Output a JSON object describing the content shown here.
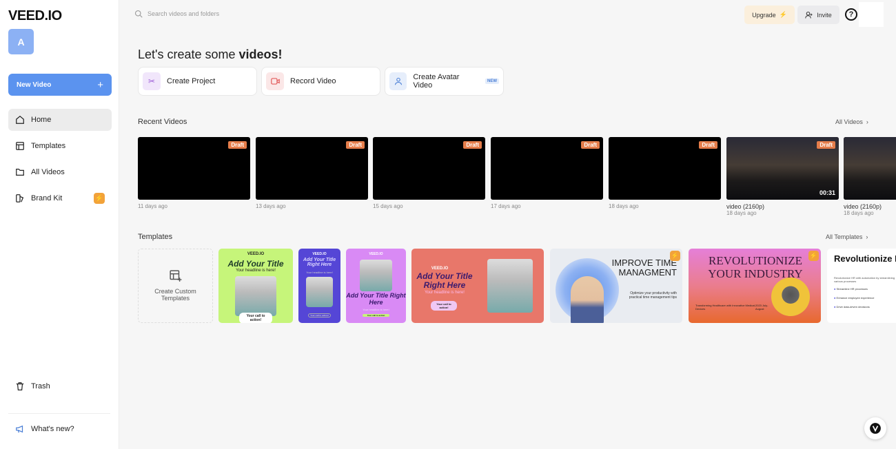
{
  "brand": {
    "logo": "VEED.IO",
    "avatar_letter": "A"
  },
  "sidebar": {
    "new_video": "New Video",
    "items": [
      {
        "label": "Home"
      },
      {
        "label": "Templates"
      },
      {
        "label": "All Videos"
      },
      {
        "label": "Brand Kit"
      }
    ],
    "trash": "Trash",
    "whats_new": "What's new?"
  },
  "header": {
    "search_placeholder": "Search videos and folders",
    "upgrade": "Upgrade",
    "invite": "Invite",
    "help": "?"
  },
  "main": {
    "title_prefix": "Let's create some ",
    "title_bold": "videos!",
    "actions": [
      {
        "label": "Create Project"
      },
      {
        "label": "Record Video"
      },
      {
        "label": "Create Avatar Video",
        "badge": "NEW"
      }
    ],
    "recent_title": "Recent Videos",
    "all_videos": "All Videos",
    "videos": [
      {
        "badge": "Draft",
        "meta": "11 days ago"
      },
      {
        "badge": "Draft",
        "meta": "13 days ago"
      },
      {
        "badge": "Draft",
        "meta": "15 days ago"
      },
      {
        "badge": "Draft",
        "meta": "17 days ago"
      },
      {
        "badge": "Draft",
        "meta": "18 days ago"
      },
      {
        "badge": "Draft",
        "title": "video (2160p)",
        "meta": "18 days ago",
        "duration": "00:31"
      },
      {
        "title": "video (2160p)",
        "meta": "18 days ago"
      }
    ],
    "templates_title": "Templates",
    "all_templates": "All Templates",
    "custom_template": "Create Custom Templates",
    "templates": [
      {
        "brand": "VEED.IO",
        "title": "Add Your Title",
        "sub": "Your headline is here!",
        "cta": "Your call to action!",
        "color": "#c6f57a"
      },
      {
        "brand": "VEED.IO",
        "title": "Add Your Title Right Here",
        "sub": "Your headline is here!",
        "cta": "Your call to action!",
        "color": "#5546d6"
      },
      {
        "brand": "VEED.IO",
        "title": "Add Your Title Right Here",
        "sub": "Your headline is here!",
        "cta": "Your call to action",
        "color": "#d98af5"
      },
      {
        "brand": "VEED.IO",
        "title": "Add Your Title Right Here",
        "sub": "Your headline is here!",
        "cta": "Your call to action!",
        "color": "#e8776a"
      },
      {
        "title": "IMPROVE TIME MANAGMENT",
        "sub": "Optimize your productivity with practical time management tips",
        "color": "#e9ecf1"
      },
      {
        "title": "REVOLUTIONIZE YOUR INDUSTRY",
        "sub": "Transforming Healthcare with Innovative Medical Devices",
        "date": "2023 July-August",
        "color": "#e57fd8"
      },
      {
        "title": "Revolutionize HR with Automation",
        "sub": "Revolutionize HR with automation by streamlining various processes",
        "items": [
          "Streamline HR processes",
          "Enhance employee experience",
          "Drive data-driven decisions"
        ],
        "color": "#ffffff"
      }
    ]
  }
}
